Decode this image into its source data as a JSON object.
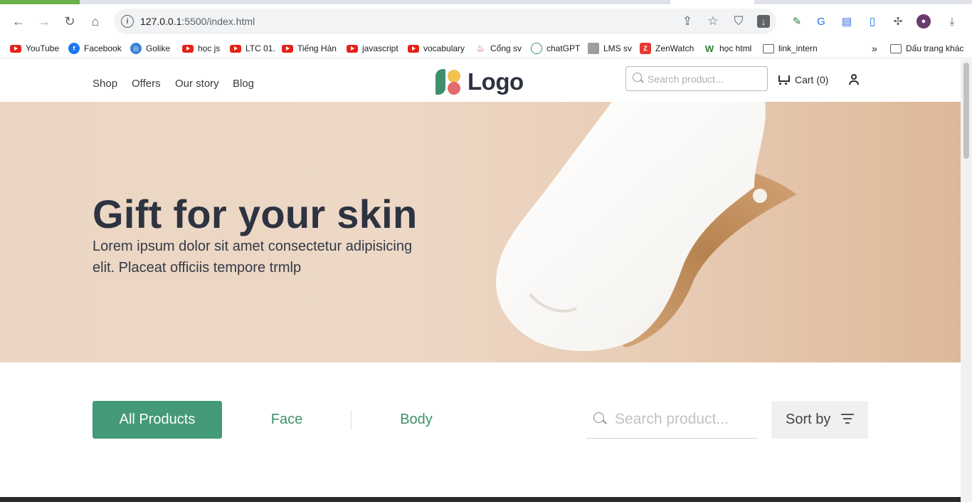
{
  "browser": {
    "url_host": "127.0.0.1",
    "url_rest": ":5500/index.html",
    "bookmarks": [
      {
        "label": "YouTube",
        "icon": "youtube-icon"
      },
      {
        "label": "Facebook",
        "icon": "facebook-icon"
      },
      {
        "label": "Golike",
        "icon": "golike-icon"
      },
      {
        "label": "học js",
        "icon": "youtube-icon"
      },
      {
        "label": "LTC 01.",
        "icon": "youtube-icon"
      },
      {
        "label": "Tiếng Hàn",
        "icon": "youtube-icon"
      },
      {
        "label": "javascript",
        "icon": "youtube-icon"
      },
      {
        "label": "vocabulary",
        "icon": "youtube-icon"
      },
      {
        "label": "Cổng sv",
        "icon": "portal-icon"
      },
      {
        "label": "chatGPT",
        "icon": "chatgpt-icon"
      },
      {
        "label": "LMS sv",
        "icon": "lms-icon"
      },
      {
        "label": "ZenWatch",
        "icon": "zenwatch-icon"
      },
      {
        "label": "học html",
        "icon": "w3-icon"
      },
      {
        "label": "link_intern",
        "icon": "folder-icon"
      }
    ],
    "bookmarks_overflow": "»",
    "other_bookmarks": "Dấu trang khác"
  },
  "header": {
    "nav": [
      "Shop",
      "Offers",
      "Our story",
      "Blog"
    ],
    "logo_text": "Logo",
    "search_placeholder": "Search product...",
    "cart_label": "Cart (0)"
  },
  "hero": {
    "title": "Gift for your skin",
    "subtitle": "Lorem ipsum dolor sit amet consectetur adipisicing elit. Placeat officiis tempore trmlp"
  },
  "filters": {
    "tabs": [
      "All Products",
      "Face",
      "Body"
    ],
    "active_tab": "All Products",
    "search_placeholder": "Search product...",
    "sort_label": "Sort by"
  },
  "colors": {
    "brand_green": "#449a76",
    "logo_yellow": "#f2c14e",
    "logo_pink": "#e46a6e",
    "hero_bg": "#ebd5c3"
  }
}
